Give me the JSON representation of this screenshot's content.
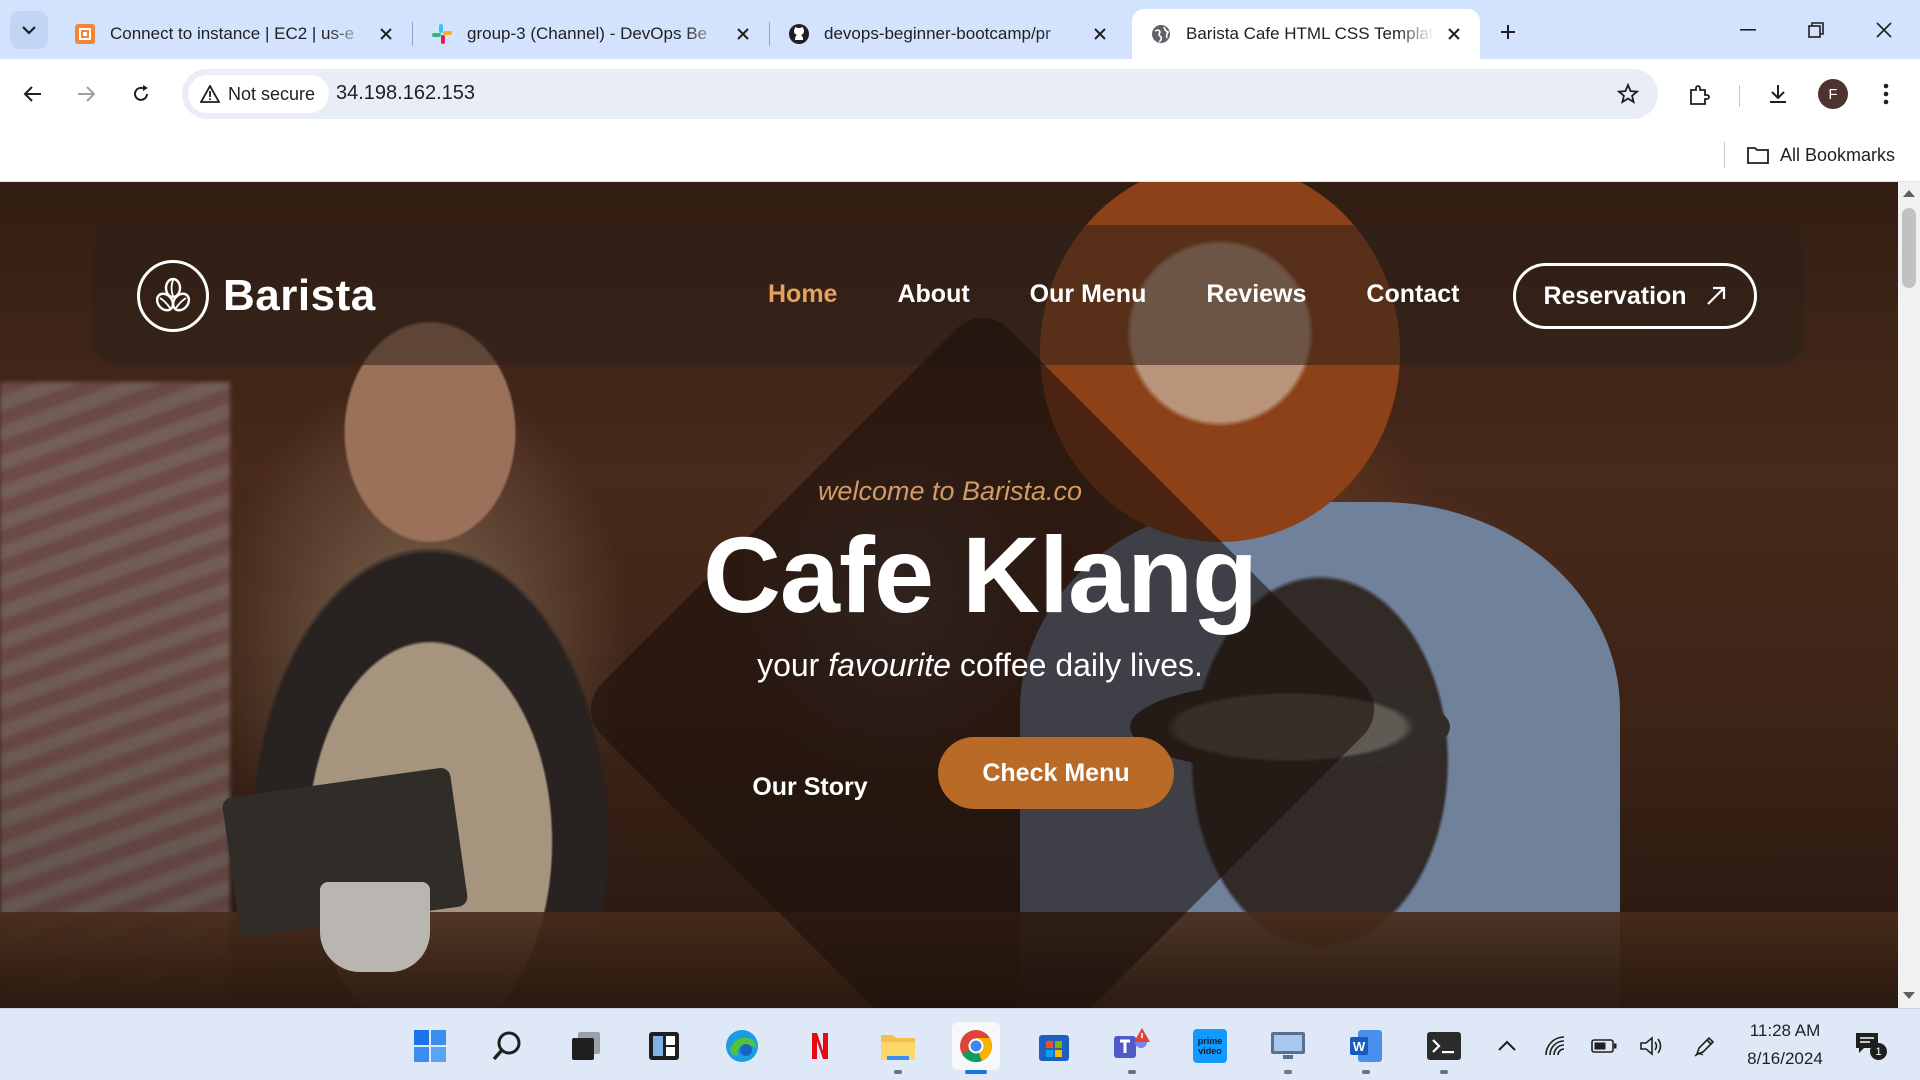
{
  "browser": {
    "tabs": [
      {
        "title": "Connect to instance | EC2 | us-e",
        "favicon": "aws-ec2-icon"
      },
      {
        "title": "group-3 (Channel) - DevOps Be",
        "favicon": "slack-icon"
      },
      {
        "title": "devops-beginner-bootcamp/pr",
        "favicon": "github-icon"
      },
      {
        "title": "Barista Cafe HTML CSS Templat",
        "favicon": "globe-icon",
        "active": true
      }
    ],
    "security_label": "Not secure",
    "url": "34.198.162.153",
    "profile_initial": "F",
    "all_bookmarks": "All Bookmarks"
  },
  "site": {
    "brand": "Barista",
    "nav": [
      "Home",
      "About",
      "Our Menu",
      "Reviews",
      "Contact"
    ],
    "active_nav": "Home",
    "reservation": "Reservation",
    "welcome": "welcome to Barista.co",
    "title": "Cafe Klang",
    "subtitle_pre": "your",
    "subtitle_em": "favourite",
    "subtitle_post": "coffee daily lives.",
    "our_story": "Our Story",
    "check_menu": "Check Menu",
    "accent_color": "#b86a26",
    "active_link_color": "#e7a15b"
  },
  "taskbar": {
    "apps": [
      "windows-start-icon",
      "search-icon",
      "task-view-icon",
      "widgets-icon",
      "edge-icon",
      "netflix-icon",
      "file-explorer-icon",
      "chrome-icon",
      "microsoft-store-icon",
      "teams-icon",
      "prime-video-icon",
      "remote-desktop-icon",
      "word-icon",
      "terminal-icon"
    ],
    "time": "11:28 AM",
    "date": "8/16/2024",
    "notification_count": "1"
  }
}
